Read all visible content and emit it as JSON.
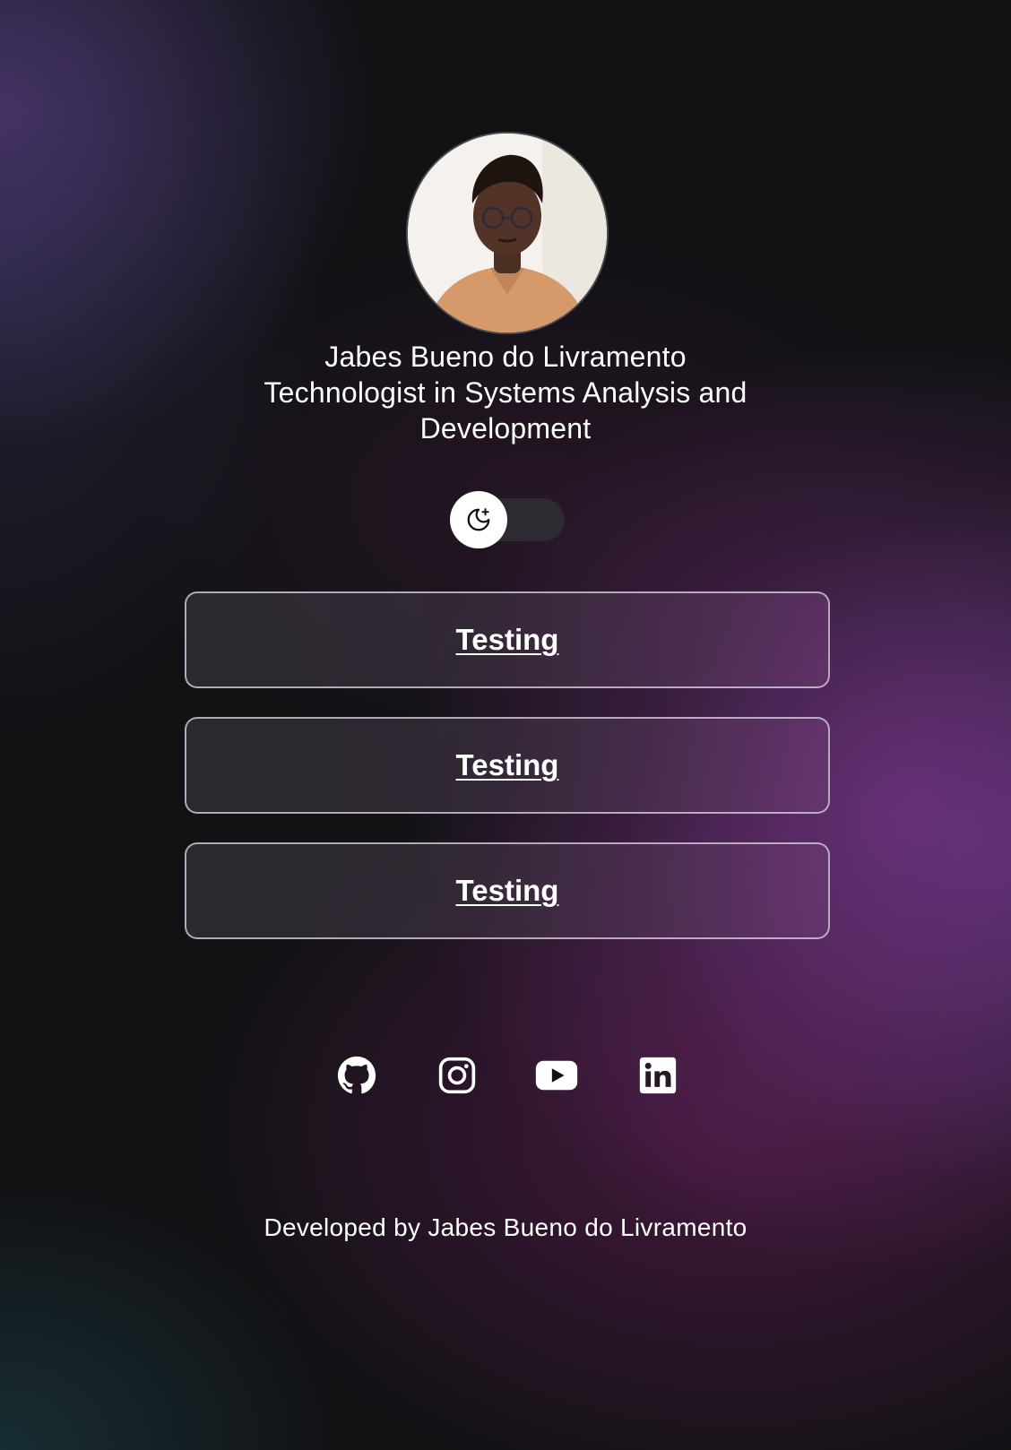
{
  "profile": {
    "name": "Jabes Bueno do Livramento",
    "title": "Technologist in Systems Analysis and Development",
    "avatar_alt": "profile photo"
  },
  "theme_toggle": {
    "state": "dark",
    "icon": "moon-stars-icon"
  },
  "links": [
    {
      "label": "Testing"
    },
    {
      "label": "Testing"
    },
    {
      "label": "Testing"
    }
  ],
  "social": [
    {
      "icon": "github-icon"
    },
    {
      "icon": "instagram-icon"
    },
    {
      "icon": "youtube-icon"
    },
    {
      "icon": "linkedin-icon"
    }
  ],
  "footer": {
    "text": "Developed by Jabes Bueno do Livramento"
  },
  "colors": {
    "background": "#121215",
    "accent_purple": "#7a3c8a",
    "text": "#ffffff",
    "button_border": "#dcd7e1"
  }
}
